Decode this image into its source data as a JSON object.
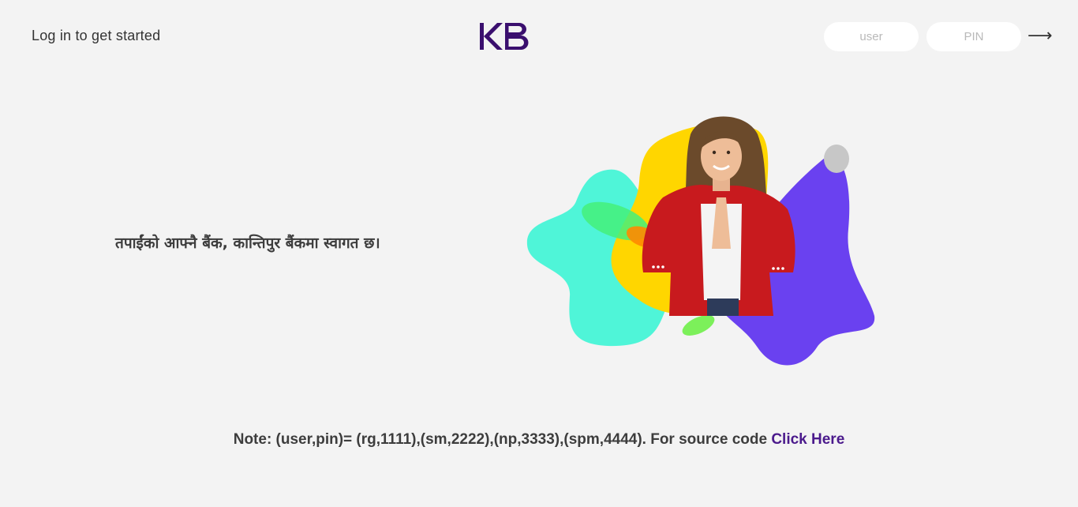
{
  "header": {
    "login_title": "Log in to get started",
    "logo_text": "KB",
    "user_placeholder": "user",
    "pin_placeholder": "PIN",
    "submit_icon": "arrow-right-icon"
  },
  "main": {
    "welcome_text": "तपाईंको आफ्नै बैंक, कान्तिपुर बैंकमा स्वागत छ।",
    "hero_image": "woman-namaste-illustration"
  },
  "footer": {
    "note_text": "Note: (user,pin)= (rg,1111),(sm,2222),(np,3333),(spm,4444). For source code ",
    "link_text": "Click Here"
  },
  "colors": {
    "background": "#f3f3f3",
    "brand": "#3a0f6e",
    "link": "#4b1a8c",
    "blob_mint": "#4ff5d8",
    "blob_yellow": "#ffd600",
    "blob_violet": "#6a41f0",
    "jacket_red": "#c81a1e"
  }
}
